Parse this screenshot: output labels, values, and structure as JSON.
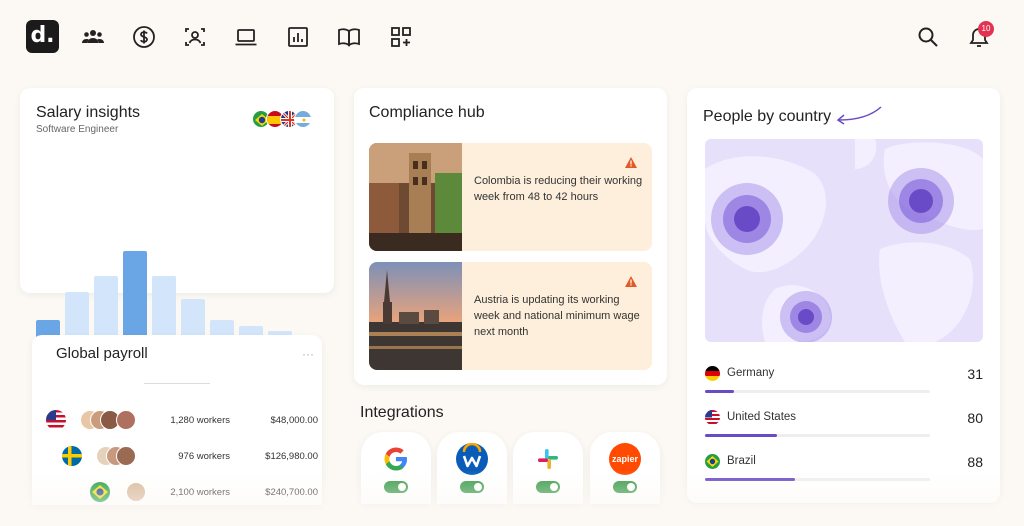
{
  "logo": {
    "text": "d."
  },
  "notifications": {
    "count": "10"
  },
  "salary": {
    "title": "Salary insights",
    "subtitle": "Software Engineer",
    "bar_levels": [
      0.4,
      0.64,
      0.78,
      1.0,
      0.78,
      0.58,
      0.4,
      0.35,
      0.3,
      0.22
    ]
  },
  "payroll": {
    "title": "Global payroll",
    "rows": [
      {
        "workers": "1,280 workers",
        "amount": "$48,000.00"
      },
      {
        "workers": "976 workers",
        "amount": "$126,980.00"
      },
      {
        "workers": "2,100 workers",
        "amount": "$240,700.00"
      }
    ]
  },
  "compliance": {
    "title": "Compliance hub",
    "items": [
      {
        "text": "Colombia is reducing their working week from 48 to 42 hours"
      },
      {
        "text": "Austria is updating its working week and national minimum wage next month"
      }
    ]
  },
  "integrations": {
    "title": "Integrations",
    "apps": [
      {
        "name": "google",
        "label": "G",
        "color": "#4285f4"
      },
      {
        "name": "workday",
        "label": "w",
        "color": "#0875e1"
      },
      {
        "name": "slack",
        "label": "#",
        "color": "#e01e5a"
      },
      {
        "name": "zapier",
        "label": "zapier",
        "color": "#ff4a00"
      }
    ],
    "toggle_color": "#3a9a4a"
  },
  "people": {
    "title": "People by country",
    "countries": [
      {
        "name": "Germany",
        "count": "31",
        "fraction": 0.13
      },
      {
        "name": "United States",
        "count": "80",
        "fraction": 0.32
      },
      {
        "name": "Brazil",
        "count": "88",
        "fraction": 0.4
      }
    ],
    "accent": "#6a4bc7"
  }
}
